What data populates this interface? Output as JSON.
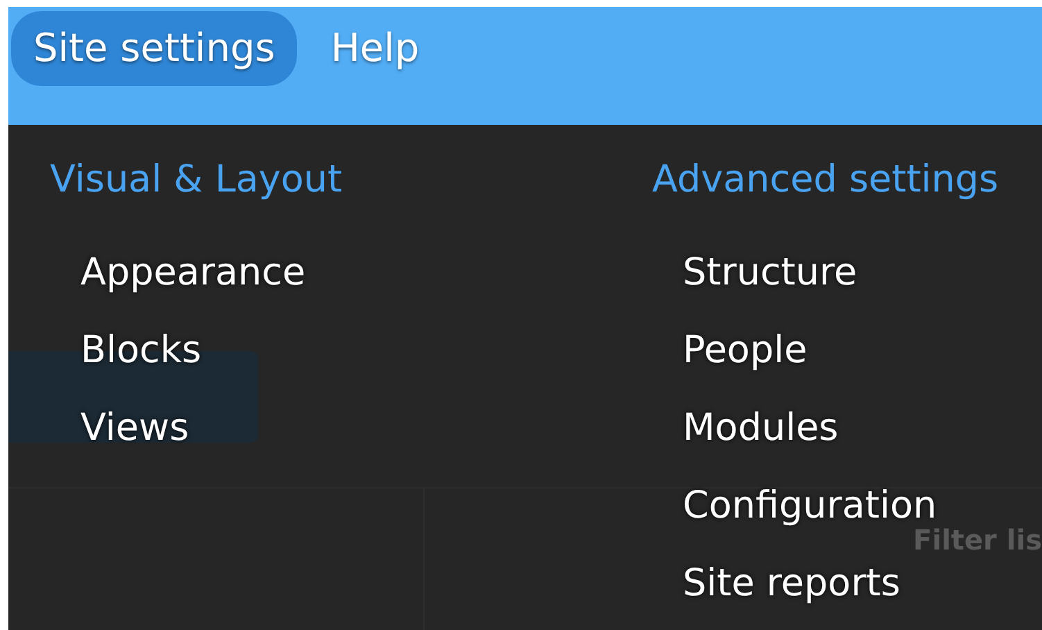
{
  "menu_bar": [
    {
      "label": "Site settings",
      "selected": true
    },
    {
      "label": "Help",
      "selected": false
    }
  ],
  "dropdown": {
    "columns": [
      {
        "heading": "Visual & Layout",
        "items": [
          "Appearance",
          "Blocks",
          "Views"
        ]
      },
      {
        "heading": "Advanced settings",
        "items": [
          "Structure",
          "People",
          "Modules",
          "Configuration",
          "Site reports"
        ]
      }
    ]
  },
  "background": {
    "filter_heading": "Filter lis"
  }
}
